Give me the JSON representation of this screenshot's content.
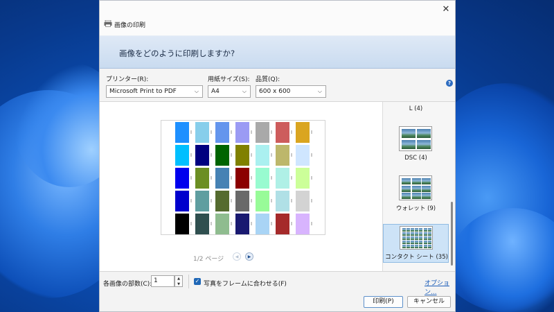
{
  "window": {
    "title": "画像の印刷",
    "close_icon": "close-icon"
  },
  "banner": {
    "heading": "画像をどのように印刷しますか?"
  },
  "settings": {
    "printer_label": "プリンター(R):",
    "printer_value": "Microsoft Print to PDF",
    "paper_label": "用紙サイズ(S):",
    "paper_value": "A4",
    "quality_label": "品質(Q):",
    "quality_value": "600 x 600",
    "help_icon": "?"
  },
  "preview": {
    "pager_text": "1/2 ページ",
    "swatch_colors": [
      [
        "#1e90ff",
        "#87ceeb",
        "#6495ed",
        "#9b9bf4",
        "#a9a9a9",
        "#cd5c5c",
        "#daa520"
      ],
      [
        "#00bfff",
        "#000080",
        "#006400",
        "#808000",
        "#aaf0f0",
        "#bdb76b",
        "#cfe6ff"
      ],
      [
        "#0000ee",
        "#6b8e23",
        "#4682b4",
        "#8b0000",
        "#98fbd0",
        "#aff0e6",
        "#ccff99"
      ],
      [
        "#0000cd",
        "#5f9ea0",
        "#556b2f",
        "#696969",
        "#98fb98",
        "#b0e0e6",
        "#d3d3d3"
      ],
      [
        "#000000",
        "#2f4f4f",
        "#8fbc8f",
        "#191970",
        "#a9d4f5",
        "#a52a2a",
        "#d8b4fe"
      ]
    ]
  },
  "layouts": {
    "items": [
      {
        "label": "L (4)"
      },
      {
        "label": "DSC (4)"
      },
      {
        "label": "ウォレット (9)"
      },
      {
        "label": "コンタクト シート (35)",
        "selected": true
      }
    ]
  },
  "footer": {
    "copies_label": "各画像の部数(C):",
    "copies_value": "1",
    "fit_label": "写真をフレームに合わせる(F)",
    "fit_checked": true,
    "options_link": "オプション...",
    "print_button": "印刷(P)",
    "cancel_button": "キャンセル"
  }
}
